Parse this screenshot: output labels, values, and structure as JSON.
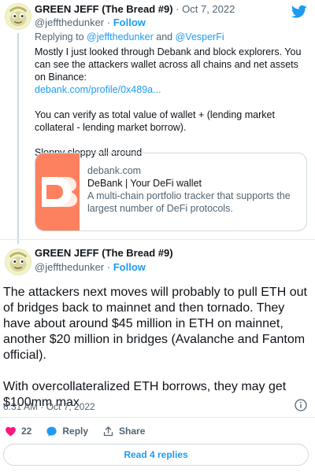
{
  "tweet1": {
    "author_name": "GREEN JEFF (The Bread #9)",
    "handle": "@jeffthedunker",
    "separator": "·",
    "date": "Oct 7, 2022",
    "follow_label": "Follow",
    "replying_prefix": "Replying to",
    "replying_to_1": "@jeffthedunker",
    "replying_and": "and",
    "replying_to_2": "@VesperFi",
    "body_line1": "Mostly I just looked through Debank and block explorers. You can see the attackers wallet across all chains and net assets on Binance:",
    "link": "debank.com/profile/0x489a...",
    "body_line2": "You can verify as total value of wallet + (lending market collateral - lending market borrow).",
    "body_line3": "Sloppy sloppy all around",
    "card": {
      "domain": "debank.com",
      "title": "DeBank | Your DeFi wallet",
      "description": "A multi-chain portfolio tracker that supports the largest number of DeFi protocols."
    }
  },
  "tweet2": {
    "author_name": "GREEN JEFF (The Bread #9)",
    "handle": "@jeffthedunker",
    "separator": "·",
    "follow_label": "Follow",
    "body_para1": "The attackers next moves will probably to pull ETH out of bridges back to mainnet and then tornado. They have about around $45 million in ETH on mainnet, another $20 million in bridges (Avalanche and Fantom official).",
    "body_para2": "With overcollateralized ETH borrows, they may get $100mm max",
    "timestamp": "6:31 AM · Oct 7, 2022",
    "like_count": "22",
    "reply_label": "Reply",
    "share_label": "Share",
    "read_replies_label": "Read 4 replies"
  },
  "colors": {
    "accent": "#1d9bf0",
    "like": "#f91880",
    "debank": "#fe815f"
  },
  "icons": [
    "twitter-bird-icon",
    "avatar",
    "debank-logo",
    "info-icon",
    "heart-icon",
    "reply-icon",
    "share-icon"
  ]
}
